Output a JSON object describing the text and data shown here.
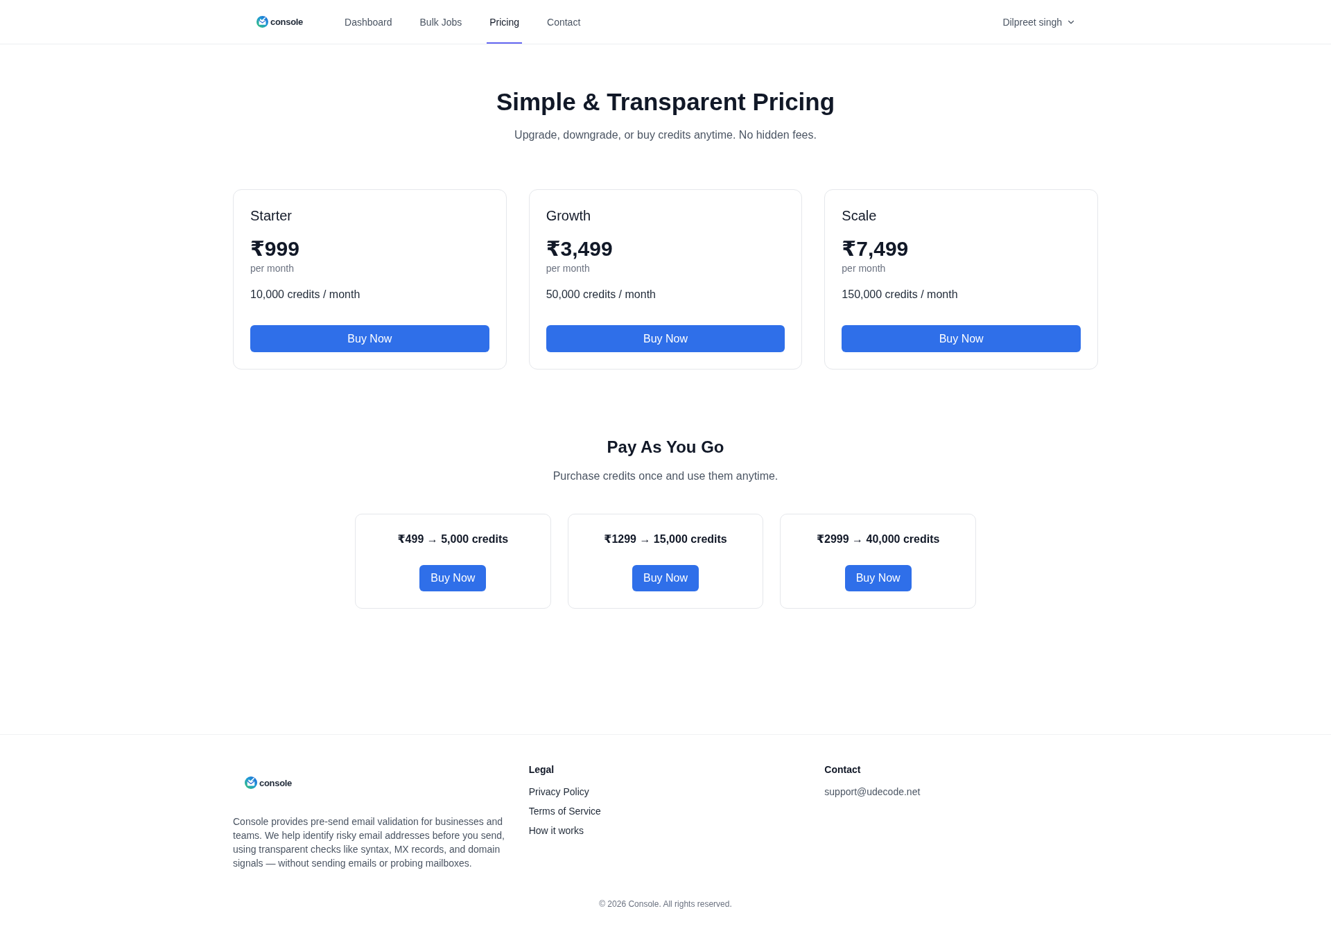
{
  "header": {
    "logo_text": "console",
    "nav": [
      {
        "label": "Dashboard",
        "selected": false
      },
      {
        "label": "Bulk Jobs",
        "selected": false
      },
      {
        "label": "Pricing",
        "selected": true
      },
      {
        "label": "Contact",
        "selected": false
      }
    ],
    "user_name": "Dilpreet singh"
  },
  "hero": {
    "title": "Simple & Transparent Pricing",
    "subtitle": "Upgrade, downgrade, or buy credits anytime. No hidden fees."
  },
  "plans": [
    {
      "name": "Starter",
      "price": "₹999",
      "period": "per month",
      "credits": "10,000 credits / month",
      "button": "Buy Now"
    },
    {
      "name": "Growth",
      "price": "₹3,499",
      "period": "per month",
      "credits": "50,000 credits / month",
      "button": "Buy Now"
    },
    {
      "name": "Scale",
      "price": "₹7,499",
      "period": "per month",
      "credits": "150,000 credits / month",
      "button": "Buy Now"
    }
  ],
  "pay_as_you_go": {
    "title": "Pay As You Go",
    "subtitle": "Purchase credits once and use them anytime.",
    "packs": [
      {
        "offer": "₹499 → 5,000 credits",
        "button": "Buy Now"
      },
      {
        "offer": "₹1299 → 15,000 credits",
        "button": "Buy Now"
      },
      {
        "offer": "₹2999 → 40,000 credits",
        "button": "Buy Now"
      }
    ]
  },
  "footer": {
    "logo_text": "console",
    "description": "Console provides pre-send email validation for businesses and teams. We help identify risky email addresses before you send, using transparent checks like syntax, MX records, and domain signals — without sending emails or probing mailboxes.",
    "columns": [
      {
        "kind": "links",
        "heading": "Legal",
        "links": [
          "Privacy Policy",
          "Terms of Service",
          "How it works"
        ]
      },
      {
        "kind": "contact",
        "heading": "Contact",
        "links": [
          "support@udecode.net"
        ]
      }
    ],
    "copyright": "© 2026 Console. All rights reserved."
  }
}
